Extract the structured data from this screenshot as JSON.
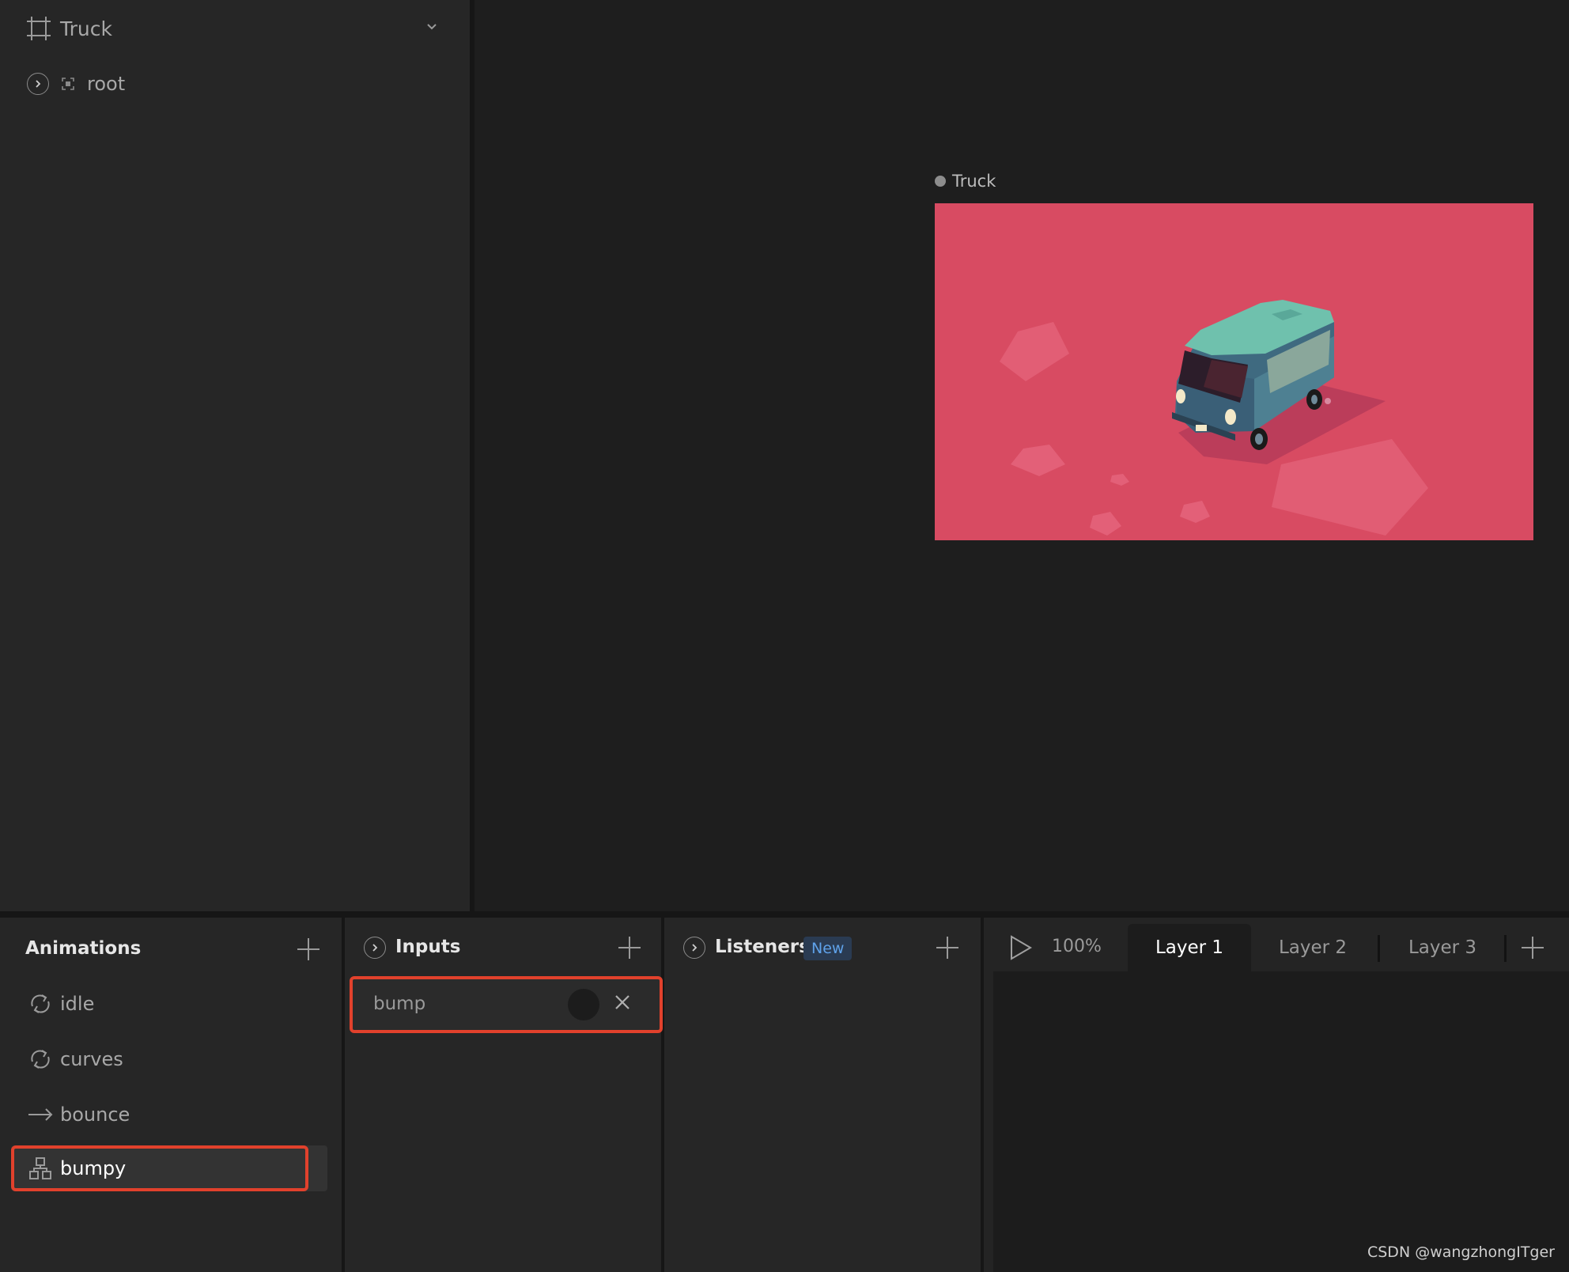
{
  "hierarchy": {
    "artboard_name": "Truck",
    "root_label": "root"
  },
  "stage": {
    "artboard_label": "Truck"
  },
  "animations": {
    "title": "Animations",
    "items": [
      {
        "label": "idle",
        "icon": "loop-icon"
      },
      {
        "label": "curves",
        "icon": "loop-icon"
      },
      {
        "label": "bounce",
        "icon": "arrow-right-icon"
      },
      {
        "label": "bumpy",
        "icon": "state-machine-icon"
      }
    ],
    "selected": "bumpy"
  },
  "inputs": {
    "title": "Inputs",
    "items": [
      {
        "label": "bump"
      }
    ]
  },
  "listeners": {
    "title": "Listeners",
    "badge": "New"
  },
  "timeline": {
    "zoom": "100%",
    "tabs": [
      "Layer 1",
      "Layer 2",
      "Layer 3"
    ],
    "active_tab": "Layer 1"
  },
  "watermark": "CSDN @wangzhongITger",
  "colors": {
    "highlight": "#e1412c",
    "artboard_bg": "#d84b62",
    "badge_text": "#5fa2ea"
  }
}
